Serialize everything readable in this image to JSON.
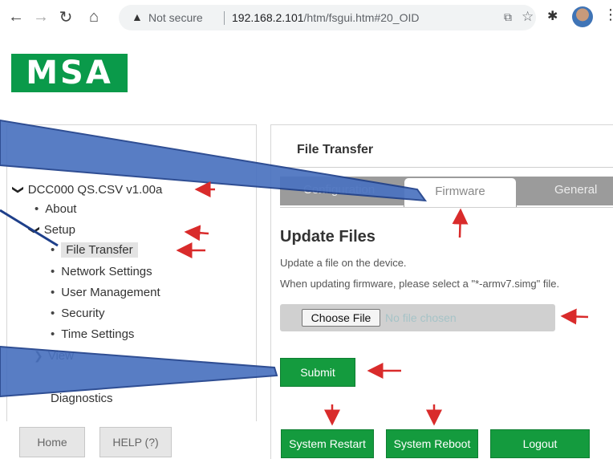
{
  "browser": {
    "security_label": "Not secure",
    "url_host": "192.168.2.101",
    "url_path": "/htm/fsgui.htm#20_OID"
  },
  "logo": {
    "text": "MSA",
    "color": "#0a9a4a"
  },
  "tree": {
    "root": "DCC000 QS.CSV v1.00a",
    "about": "About",
    "setup": "Setup",
    "setup_items": [
      "File Transfer",
      "Network Settings",
      "User Management",
      "Security",
      "Time Settings"
    ],
    "view": "View",
    "diagnostics": "Diagnostics"
  },
  "left_buttons": {
    "home": "Home",
    "help": "HELP (?)"
  },
  "panel": {
    "title": "File Transfer",
    "tabs": {
      "configuration": "Configuration",
      "firmware": "Firmware",
      "general": "General"
    },
    "heading": "Update Files",
    "line1": "Update a file on the device.",
    "line2": "When updating firmware, please select a \"*-armv7.simg\" file.",
    "choose_file": "Choose File",
    "no_file": "No file chosen",
    "submit": "Submit",
    "system_restart": "System Restart",
    "system_reboot": "System Reboot",
    "logout": "Logout"
  },
  "colors": {
    "brand_green": "#149b3e",
    "annotation_arrow": "#d92b2b",
    "callout_blue": "#3f67b4"
  }
}
